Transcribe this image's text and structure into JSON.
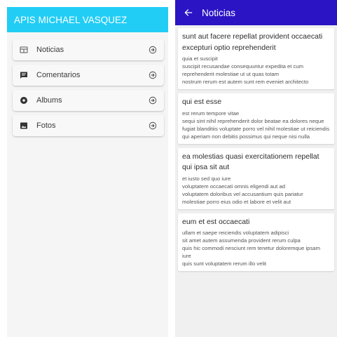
{
  "colors": {
    "left_appbar": "#21cdf5",
    "right_appbar": "#2a14c4",
    "background": "#f5f5f5"
  },
  "home": {
    "title": "APIS MICHAEL VASQUEZ",
    "menu": [
      {
        "label": "Noticias",
        "icon": "newspaper-icon"
      },
      {
        "label": "Comentarios",
        "icon": "comment-icon"
      },
      {
        "label": "Albums",
        "icon": "album-icon"
      },
      {
        "label": "Fotos",
        "icon": "photo-icon"
      }
    ],
    "arrow_icon": "arrow-circle-right-icon"
  },
  "posts_screen": {
    "title": "Noticias",
    "back_icon": "back-arrow-icon",
    "posts": [
      {
        "title": "sunt aut facere repellat provident occaecati excepturi optio reprehenderit",
        "body": "quia et suscipit\nsuscipit recusandae consequuntur expedita et cum\nreprehenderit molestiae ut ut quas totam\nnostrum rerum est autem sunt rem eveniet architecto"
      },
      {
        "title": "qui est esse",
        "body": "est rerum tempore vitae\nsequi sint nihil reprehenderit dolor beatae ea dolores neque\nfugiat blanditiis voluptate porro vel nihil molestiae ut reiciendis\nqui aperiam non debitis possimus qui neque nisi nulla"
      },
      {
        "title": "ea molestias quasi exercitationem repellat qui ipsa sit aut",
        "body": "et iusto sed quo iure\nvoluptatem occaecati omnis eligendi aut ad\nvoluptatem doloribus vel accusantium quis pariatur\nmolestiae porro eius odio et labore et velit aut"
      },
      {
        "title": "eum et est occaecati",
        "body": "ullam et saepe reiciendis voluptatem adipisci\nsit amet autem assumenda provident rerum culpa\nquis hic commodi nesciunt rem tenetur doloremque ipsam iure\nquis sunt voluptatem rerum illo velit"
      }
    ]
  }
}
